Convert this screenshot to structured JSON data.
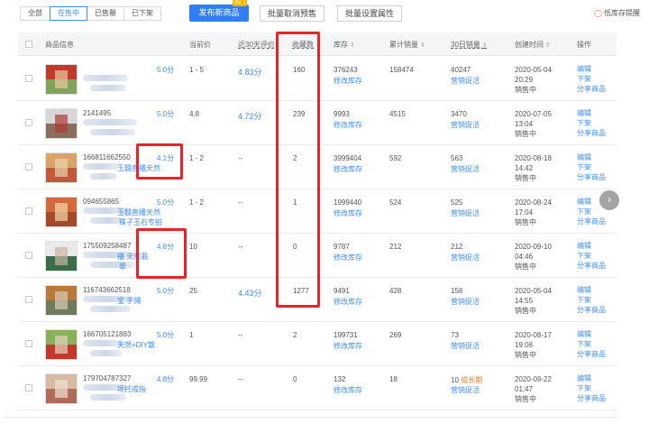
{
  "tabs": [
    {
      "label": "全部",
      "active": false
    },
    {
      "label": "在售中",
      "active": true
    },
    {
      "label": "已售罄",
      "active": false
    },
    {
      "label": "已下架",
      "active": false
    }
  ],
  "toolbar": {
    "publish_label": "发布新商品",
    "publish_badge": "热门",
    "batch_cancel_presale_label": "批量取消预售",
    "batch_set_attr_label": "批量设置属性",
    "low_stock_label": "低库存提醒"
  },
  "columns": {
    "product_info": "商品信息",
    "price": "当前价",
    "rating30": "近30天评价",
    "favorites": "收藏数",
    "stock": "库存",
    "total_sales": "累计销量",
    "sales30": "30日销量",
    "created": "创建时间",
    "actions": "操作"
  },
  "links": {
    "edit_stock": "修改库存",
    "promote": "营销促活",
    "edit": "编辑",
    "take_down": "下架",
    "share": "分享商品"
  },
  "rows": [
    {
      "pid": "",
      "rating_badge": "5.0分",
      "name": "",
      "name2": "",
      "price": "1 - 5",
      "rating30": "4.83分",
      "favorites": "160",
      "stock": "376243",
      "total_sales": "158474",
      "sales30": "40247",
      "growth": "",
      "created_date": "2020-05-04",
      "created_time": "20:29",
      "status": "销售中"
    },
    {
      "pid": "2141495",
      "rating_badge": "5.0分",
      "name": "",
      "name2": "",
      "price": "4.8",
      "rating30": "4.72分",
      "favorites": "239",
      "stock": "9993",
      "total_sales": "4515",
      "sales30": "3470",
      "growth": "",
      "created_date": "2020-07-05",
      "created_time": "13:04",
      "status": "销售中"
    },
    {
      "pid": "166811662550",
      "rating_badge": "4.1分",
      "name": "玉髓直播天然",
      "name2": "",
      "price": "1 - 2",
      "rating30": "--",
      "favorites": "2",
      "stock": "3999404",
      "total_sales": "592",
      "sales30": "563",
      "growth": "",
      "created_date": "2020-08-18",
      "created_time": "14:42",
      "status": "销售中"
    },
    {
      "pid": "094655865",
      "rating_badge": "5.0分",
      "name": "玉髓直播天然",
      "name2": "珠子玉石专拍",
      "price": "1 - 2",
      "rating30": "--",
      "favorites": "1",
      "stock": "1999440",
      "total_sales": "524",
      "sales30": "525",
      "growth": "",
      "created_date": "2020-08-24",
      "created_time": "17:04",
      "status": "销售中"
    },
    {
      "pid": "175509258487",
      "rating_badge": "4.8分",
      "name": "播 天然翡",
      "name2": "翠",
      "price": "10",
      "rating30": "--",
      "favorites": "0",
      "stock": "9787",
      "total_sales": "212",
      "sales30": "212",
      "growth": "",
      "created_date": "2020-09-10",
      "created_time": "04:46",
      "status": "销售中"
    },
    {
      "pid": "116743662518",
      "rating_badge": "5.0分",
      "name": "宝 手镯",
      "name2": "",
      "price": "25",
      "rating30": "4.43分",
      "favorites": "1277",
      "stock": "9491",
      "total_sales": "428",
      "sales30": "158",
      "growth": "",
      "created_date": "2020-05-04",
      "created_time": "14:55",
      "status": "销售中"
    },
    {
      "pid": "166705121883",
      "rating_badge": "5.0分",
      "name": "天然+DIY散",
      "name2": "",
      "price": "1",
      "rating30": "--",
      "favorites": "2",
      "stock": "199731",
      "total_sales": "269",
      "sales30": "73",
      "growth": "",
      "created_date": "2020-08-17",
      "created_time": "19:08",
      "status": "销售中"
    },
    {
      "pid": "179704787327",
      "rating_badge": "4.8分",
      "name": "项托戒指",
      "name2": "",
      "price": "99.99",
      "rating30": "--",
      "favorites": "0",
      "stock": "132",
      "total_sales": "18",
      "sales30": "10",
      "growth": "成长期",
      "created_date": "2020-09-22",
      "created_time": "01:47",
      "status": "销售中"
    }
  ],
  "thumb_colors": [
    [
      "#c0392b",
      "#7fa35a",
      "#e8c9a0"
    ],
    [
      "#d7d7d7",
      "#8a6d5a",
      "#b13a3a"
    ],
    [
      "#d9a46a",
      "#c05a3a",
      "#e9d3b2"
    ],
    [
      "#d46a3a",
      "#a44a2a",
      "#f2d7a8"
    ],
    [
      "#e9e9e9",
      "#3a6d4a",
      "#c7b3a3"
    ],
    [
      "#b77a3a",
      "#6e7a5a",
      "#d8cbb6"
    ],
    [
      "#8ab05a",
      "#c0392b",
      "#e3d2c0"
    ],
    [
      "#d8b9a4",
      "#b06a5a",
      "#f0e0d0"
    ]
  ],
  "colors": {
    "accent": "#2f7ef6",
    "highlight": "#e8242b",
    "growth": "#ff7a1a"
  }
}
